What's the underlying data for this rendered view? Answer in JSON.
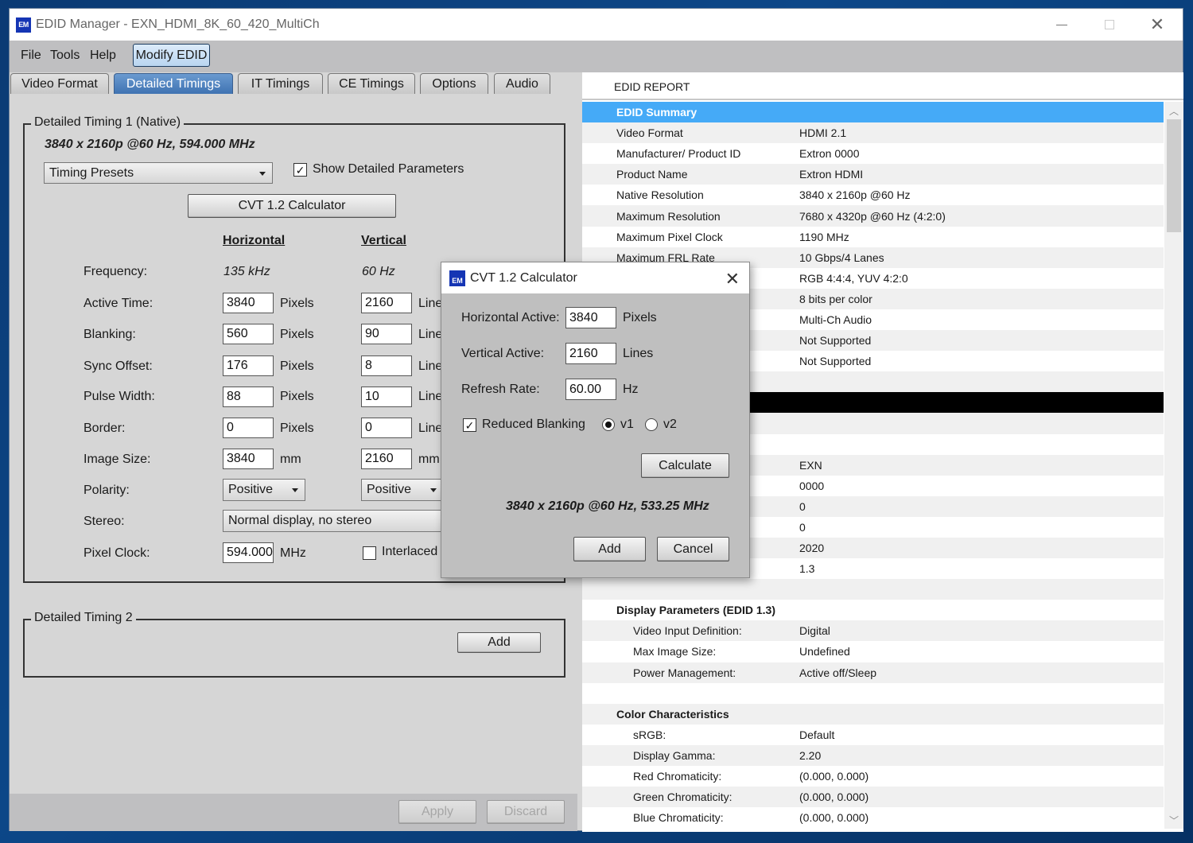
{
  "window": {
    "title": "EDID Manager - EXN_HDMI_8K_60_420_MultiCh",
    "app_icon": "EM"
  },
  "menubar": {
    "items": [
      "File",
      "Tools",
      "Help"
    ],
    "modify_label": "Modify EDID"
  },
  "tabs": [
    {
      "label": "Video Format",
      "active": false
    },
    {
      "label": "Detailed Timings",
      "active": true
    },
    {
      "label": "IT Timings",
      "active": false
    },
    {
      "label": "CE Timings",
      "active": false
    },
    {
      "label": "Options",
      "active": false
    },
    {
      "label": "Audio",
      "active": false
    }
  ],
  "timing1": {
    "legend": "Detailed Timing 1 (Native)",
    "summary": "3840 x 2160p @60 Hz, 594.000 MHz",
    "presets": "Timing Presets",
    "show_detailed_label": "Show Detailed Parameters",
    "show_detailed_checked": true,
    "cvt_button": "CVT 1.2 Calculator",
    "col_h": "Horizontal",
    "col_v": "Vertical",
    "frequency_label": "Frequency:",
    "freq_h": "135 kHz",
    "freq_v": "60 Hz",
    "rows": [
      {
        "label": "Active Time:",
        "h": "3840",
        "h_unit": "Pixels",
        "v": "2160",
        "v_unit": "Lines"
      },
      {
        "label": "Blanking:",
        "h": "560",
        "h_unit": "Pixels",
        "v": "90",
        "v_unit": "Lines"
      },
      {
        "label": "Sync Offset:",
        "h": "176",
        "h_unit": "Pixels",
        "v": "8",
        "v_unit": "Lines"
      },
      {
        "label": "Pulse Width:",
        "h": "88",
        "h_unit": "Pixels",
        "v": "10",
        "v_unit": "Lines"
      },
      {
        "label": "Border:",
        "h": "0",
        "h_unit": "Pixels",
        "v": "0",
        "v_unit": "Lines"
      },
      {
        "label": "Image Size:",
        "h": "3840",
        "h_unit": "mm",
        "v": "2160",
        "v_unit": "mm"
      }
    ],
    "polarity_label": "Polarity:",
    "polarity_h": "Positive",
    "polarity_v": "Positive",
    "stereo_label": "Stereo:",
    "stereo_value": "Normal display, no stereo",
    "pixel_clock_label": "Pixel Clock:",
    "pixel_clock": "594.000",
    "pixel_clock_unit": "MHz",
    "interlaced_label": "Interlaced",
    "interlaced_checked": false
  },
  "timing2": {
    "legend": "Detailed Timing 2",
    "add_button": "Add"
  },
  "footer": {
    "apply": "Apply",
    "discard": "Discard"
  },
  "report": {
    "title": "EDID REPORT",
    "rows": [
      {
        "k": "EDID Summary",
        "v": "",
        "type": "header"
      },
      {
        "k": "Video Format",
        "v": "HDMI 2.1"
      },
      {
        "k": "Manufacturer/ Product ID",
        "v": "Extron 0000"
      },
      {
        "k": "Product Name",
        "v": "Extron HDMI"
      },
      {
        "k": "Native Resolution",
        "v": "3840 x 2160p @60 Hz"
      },
      {
        "k": "Maximum Resolution",
        "v": "7680 x 4320p @60 Hz (4:2:0)"
      },
      {
        "k": "Maximum Pixel Clock",
        "v": "1190 MHz"
      },
      {
        "k": "Maximum FRL Rate",
        "v": "10 Gbps/4 Lanes"
      },
      {
        "k": "",
        "v": "RGB 4:4:4, YUV 4:2:0"
      },
      {
        "k": "",
        "v": "8 bits per color"
      },
      {
        "k": "",
        "v": "Multi-Ch Audio"
      },
      {
        "k": "",
        "v": "Not Supported"
      },
      {
        "k": "",
        "v": "Not Supported"
      },
      {
        "k": "",
        "v": ""
      },
      {
        "k": "",
        "v": "",
        "type": "black"
      },
      {
        "k": "",
        "v": ""
      },
      {
        "k": "",
        "v": ""
      },
      {
        "k": "",
        "v": "EXN"
      },
      {
        "k": "",
        "v": "0000"
      },
      {
        "k": "",
        "v": "0"
      },
      {
        "k": "",
        "v": "0"
      },
      {
        "k": "",
        "v": "2020"
      },
      {
        "k": "",
        "v": "1.3"
      },
      {
        "k": "",
        "v": ""
      },
      {
        "k": "Display Parameters (EDID 1.3)",
        "v": "",
        "type": "bold"
      },
      {
        "k": "Video Input Definition:",
        "v": "Digital",
        "indent": true
      },
      {
        "k": "Max Image Size:",
        "v": "Undefined",
        "indent": true
      },
      {
        "k": "Power Management:",
        "v": "Active off/Sleep",
        "indent": true
      },
      {
        "k": "",
        "v": ""
      },
      {
        "k": "Color Characteristics",
        "v": "",
        "type": "bold"
      },
      {
        "k": "sRGB:",
        "v": "Default",
        "indent": true
      },
      {
        "k": "Display Gamma:",
        "v": "2.20",
        "indent": true
      },
      {
        "k": "Red Chromaticity:",
        "v": "(0.000, 0.000)",
        "indent": true
      },
      {
        "k": "Green Chromaticity:",
        "v": "(0.000, 0.000)",
        "indent": true
      },
      {
        "k": "Blue Chromaticity:",
        "v": "(0.000, 0.000)",
        "indent": true
      }
    ]
  },
  "dialog": {
    "title": "CVT 1.2 Calculator",
    "icon": "EM",
    "h_active_label": "Horizontal Active:",
    "h_active": "3840",
    "h_unit": "Pixels",
    "v_active_label": "Vertical Active:",
    "v_active": "2160",
    "v_unit": "Lines",
    "refresh_label": "Refresh Rate:",
    "refresh": "60.00",
    "refresh_unit": "Hz",
    "reduced_blanking_label": "Reduced Blanking",
    "reduced_blanking_checked": true,
    "v1_label": "v1",
    "v2_label": "v2",
    "selected_version": "v1",
    "calculate": "Calculate",
    "result": "3840 x 2160p @60 Hz, 533.25 MHz",
    "add": "Add",
    "cancel": "Cancel"
  }
}
